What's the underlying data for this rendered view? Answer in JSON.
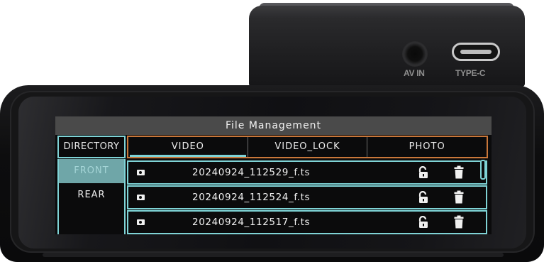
{
  "device": {
    "ports": {
      "av_label": "AV IN",
      "typec_label": "TYPE-C"
    }
  },
  "screen": {
    "title": "File Management",
    "directory_header": "DIRECTORY",
    "tabs": [
      {
        "label": "VIDEO",
        "active": true
      },
      {
        "label": "VIDEO_LOCK",
        "active": false
      },
      {
        "label": "PHOTO",
        "active": false
      }
    ],
    "directories": [
      {
        "label": "FRONT",
        "selected": true
      },
      {
        "label": "REAR",
        "selected": false
      }
    ],
    "files": [
      {
        "name": "20240924_112529_f.ts",
        "icon": "video-camera-icon",
        "locked": false
      },
      {
        "name": "20240924_112524_f.ts",
        "icon": "video-camera-icon",
        "locked": false
      },
      {
        "name": "20240924_112517_f.ts",
        "icon": "video-camera-icon",
        "locked": false
      }
    ],
    "colors": {
      "accent": "#7fd3d6",
      "tab_border": "#c9773a",
      "selected_bg": "#6fa6a8",
      "title_bg": "#4a4a4a"
    }
  }
}
